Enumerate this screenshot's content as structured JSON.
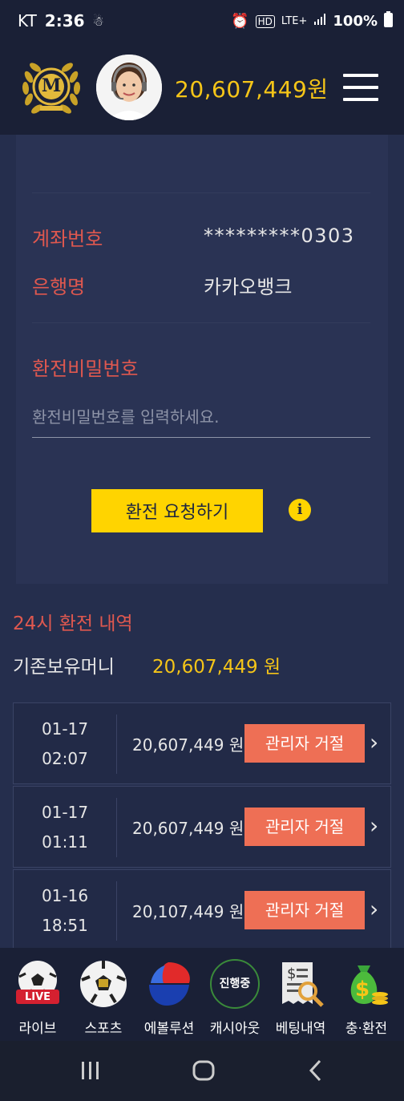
{
  "status_bar": {
    "carrier": "KT",
    "time": "2:36",
    "network": "LTE+",
    "battery": "100%"
  },
  "header": {
    "balance": "20,607,449원",
    "logo_letter": "M"
  },
  "account": {
    "account_label": "계좌번호",
    "account_value": "*********0303",
    "bank_label": "은행명",
    "bank_value": "카카오뱅크",
    "password_label": "환전비밀번호",
    "password_placeholder": "환전비밀번호를 입력하세요.",
    "submit_label": "환전 요청하기",
    "info_icon": "i"
  },
  "history": {
    "title": "24시 환전 내역",
    "hold_label": "기존보유머니",
    "hold_value": "20,607,449 원",
    "rows": [
      {
        "date": "01-17",
        "time": "02:07",
        "amount": "20,607,449 원",
        "status": "관리자 거절"
      },
      {
        "date": "01-17",
        "time": "01:11",
        "amount": "20,607,449 원",
        "status": "관리자 거절"
      },
      {
        "date": "01-16",
        "time": "18:51",
        "amount": "20,107,449 원",
        "status": "관리자 거절"
      }
    ]
  },
  "bottom_nav": [
    {
      "label": "라이브",
      "icon": "live-soccer-icon",
      "badge": "LIVE"
    },
    {
      "label": "스포츠",
      "icon": "soccer-ball-icon"
    },
    {
      "label": "에볼루션",
      "icon": "evolution-icon"
    },
    {
      "label": "캐시아웃",
      "icon": "cashout-icon",
      "badge": "진행중"
    },
    {
      "label": "베팅내역",
      "icon": "betting-receipt-icon"
    },
    {
      "label": "충·환전",
      "icon": "money-bag-icon"
    }
  ],
  "colors": {
    "accent_yellow": "#f5c518",
    "label_red": "#e0584f",
    "reject_orange": "#ee6f55",
    "bg": "#252e4d"
  }
}
